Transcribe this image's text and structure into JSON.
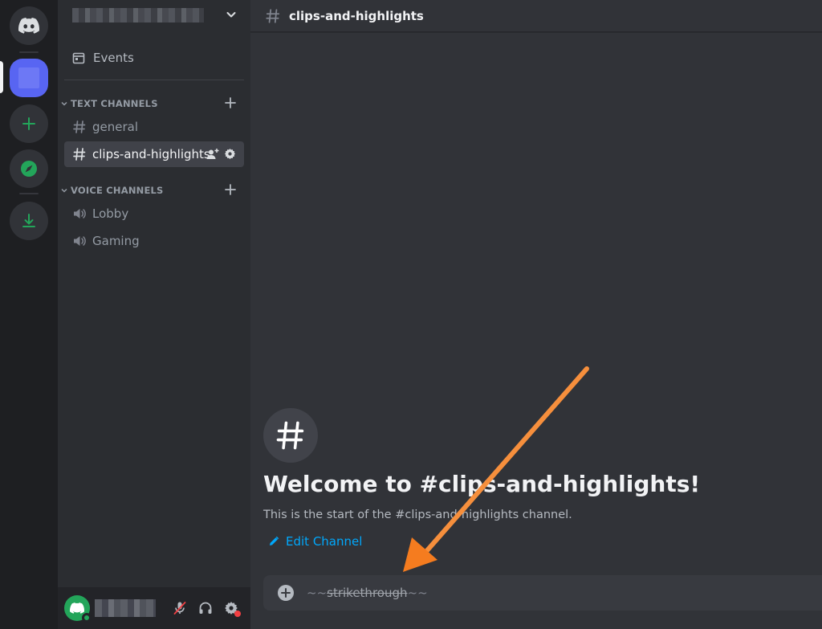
{
  "sidebar": {
    "events_label": "Events",
    "categories": [
      {
        "label": "TEXT CHANNELS"
      },
      {
        "label": "VOICE CHANNELS"
      }
    ],
    "text_channels": [
      {
        "label": "general"
      },
      {
        "label": "clips-and-highlights"
      }
    ],
    "voice_channels": [
      {
        "label": "Lobby"
      },
      {
        "label": "Gaming"
      }
    ]
  },
  "header": {
    "channel_name": "clips-and-highlights"
  },
  "welcome": {
    "title": "Welcome to #clips-and-highlights!",
    "subtitle": "This is the start of the #clips-and-highlights channel.",
    "edit_label": "Edit Channel"
  },
  "composer": {
    "prefix": "~~",
    "text": "strikethrough",
    "suffix": "~~"
  },
  "colors": {
    "accent": "#5865f2",
    "link": "#00a8fc",
    "online": "#23a55a",
    "arrow": "#f57c1f",
    "alert": "#f23f43"
  }
}
